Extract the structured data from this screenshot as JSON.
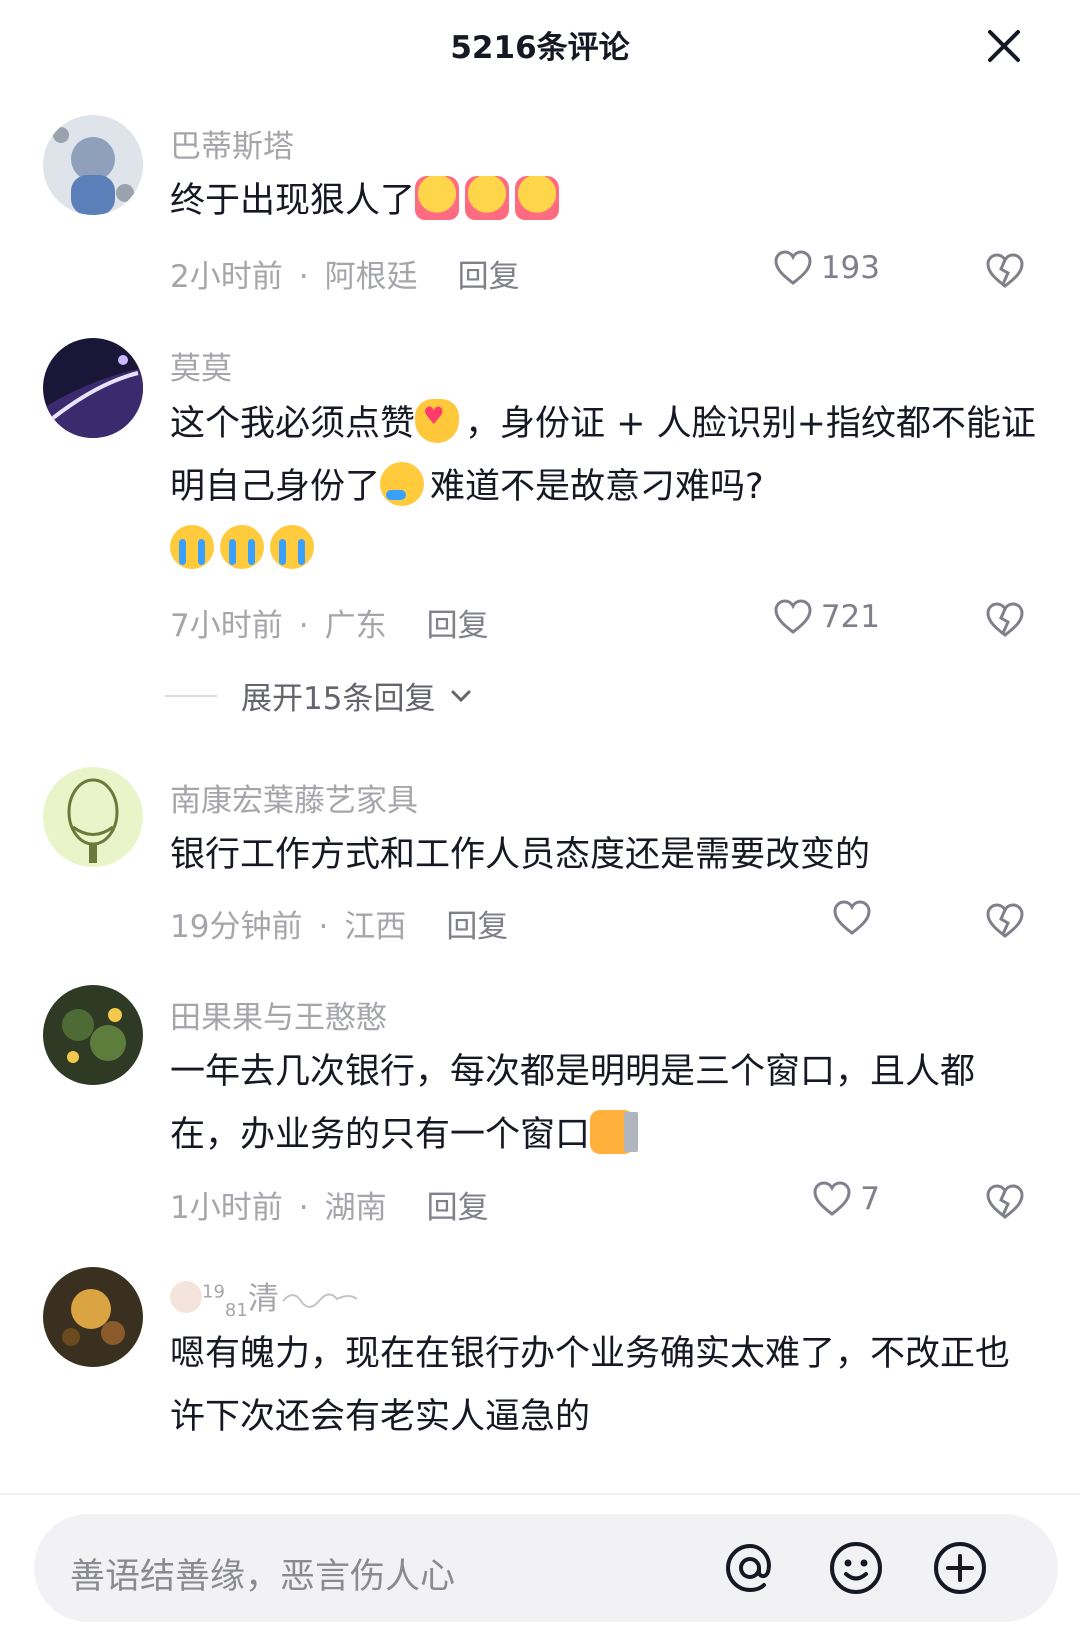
{
  "header": {
    "title": "5216条评论"
  },
  "comments": [
    {
      "username": "巴蒂斯塔",
      "text": "终于出现狠人了",
      "time": "2小时前",
      "location": "阿根廷",
      "reply": "回复",
      "likes": "193",
      "emojis": [
        "thumbs-up",
        "thumbs-up",
        "thumbs-up"
      ]
    },
    {
      "username": "莫莫",
      "text1": "这个我必须点赞",
      "text2": "，身份证 + 人脸识别+指纹都不能证明自己身份了",
      "text3": "难道不是故意刁难吗?",
      "time": "7小时前",
      "location": "广东",
      "reply": "回复",
      "likes": "721",
      "expand": "展开15条回复"
    },
    {
      "username": "南康宏葉藤艺家具",
      "text": "银行工作方式和工作人员态度还是需要改变的",
      "time": "19分钟前",
      "location": "江西",
      "reply": "回复",
      "likes": ""
    },
    {
      "username": "田果果与王憨憨",
      "text": "一年去几次银行，每次都是明明是三个窗口，且人都在，办业务的只有一个窗口",
      "time": "1小时前",
      "location": "湖南",
      "reply": "回复",
      "likes": "7"
    },
    {
      "username_sup": "19",
      "username_sub": "81",
      "username": "清",
      "text": "嗯有魄力，现在在银行办个业务确实太难了，不改正也许下次还会有老实人逼急的"
    }
  ],
  "input": {
    "placeholder": "善语结善缘，恶言伤人心"
  },
  "colors": {
    "meta": "#a5a6ab",
    "text": "#161823",
    "input_bg": "#f2f2f4"
  },
  "icons": [
    "close-icon",
    "heart-icon",
    "dislike-heart-icon",
    "chevron-down-icon",
    "at-icon",
    "emoji-icon",
    "plus-icon"
  ]
}
